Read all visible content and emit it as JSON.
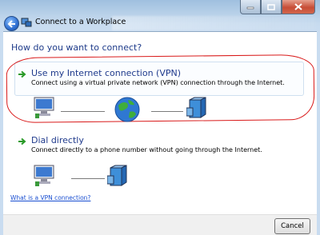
{
  "window": {
    "title": "Connect to a Workplace"
  },
  "heading": "How do you want to connect?",
  "options": [
    {
      "title": "Use my Internet connection (VPN)",
      "description": "Connect using a virtual private network (VPN) connection through the Internet."
    },
    {
      "title": "Dial directly",
      "description": "Connect directly to a phone number without going through the Internet."
    }
  ],
  "link": "What is a VPN connection?",
  "footer": {
    "cancel_label": "Cancel"
  },
  "colors": {
    "heading": "#1e3b8a",
    "highlight": "#d91a1a",
    "link": "#1a4fd1"
  },
  "icons": [
    "back-arrow-icon",
    "network-icon",
    "green-arrow-icon",
    "computer-icon",
    "globe-icon",
    "server-icon",
    "modem-icon"
  ]
}
